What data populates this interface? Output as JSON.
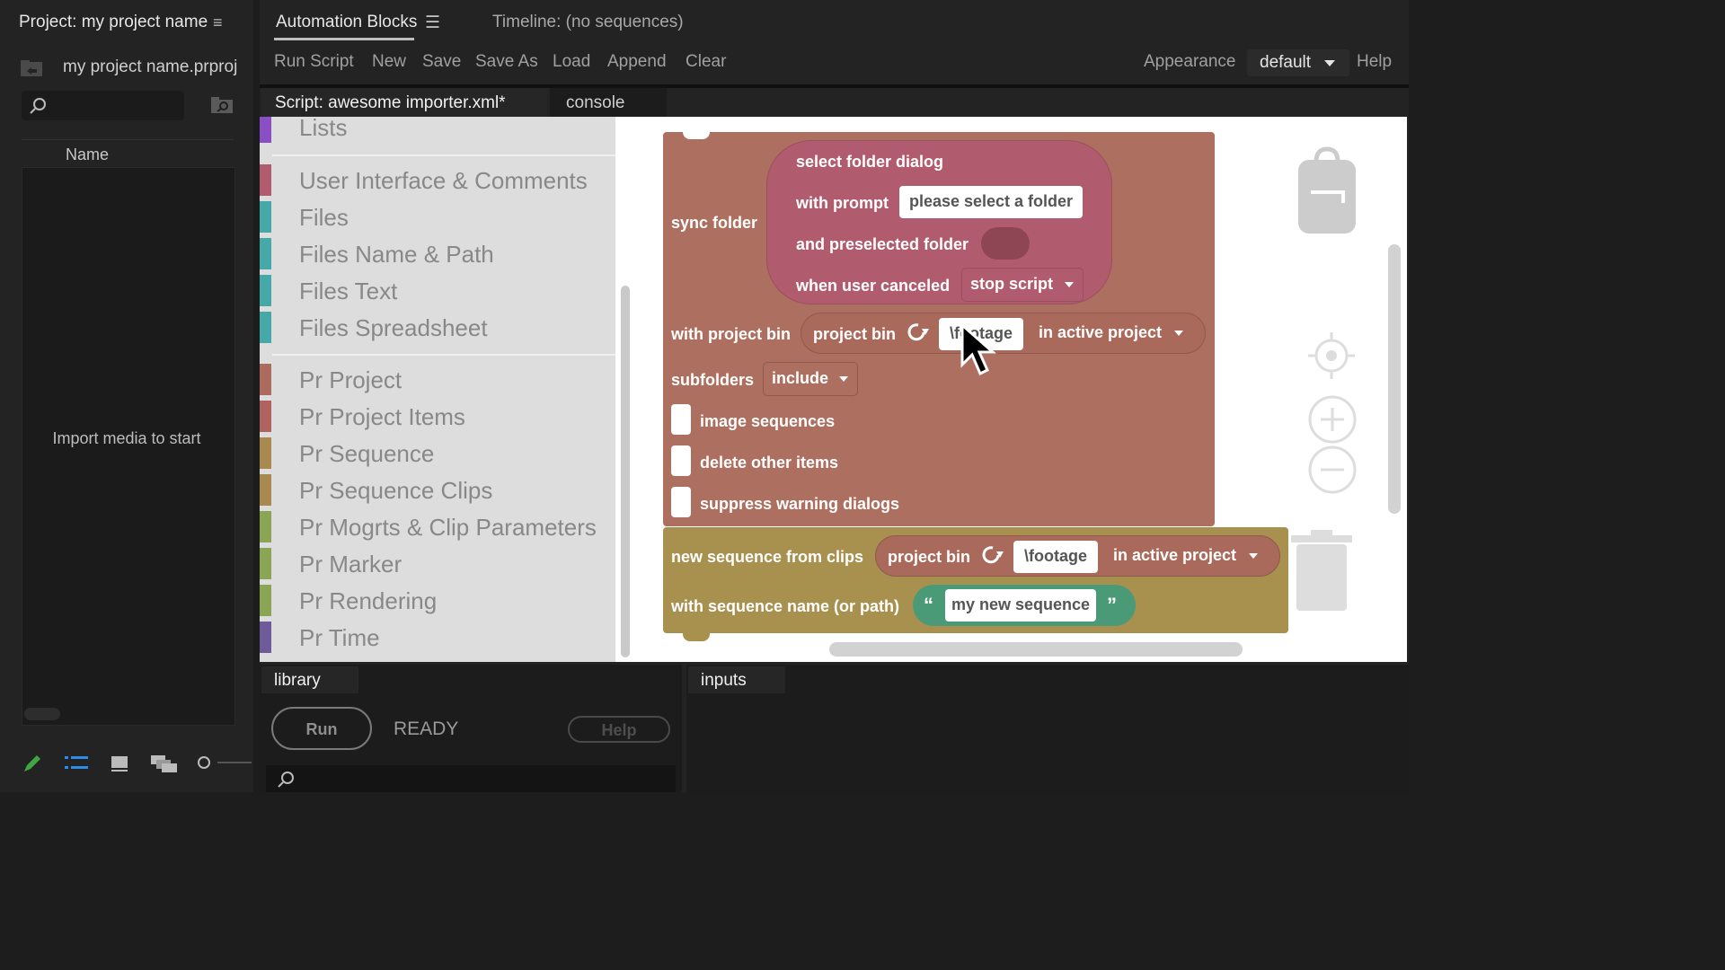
{
  "project_panel": {
    "title": "Project: my project name",
    "menu_icon": "hamburger-icon",
    "file_name": "my project name.prproj",
    "column_header": "Name",
    "empty_message": "Import media to start"
  },
  "tabs": {
    "automation": "Automation Blocks",
    "timeline": "Timeline: (no sequences)"
  },
  "toolbar": {
    "run_script": "Run Script",
    "new": "New",
    "save": "Save",
    "save_as": "Save As",
    "load": "Load",
    "append": "Append",
    "clear": "Clear",
    "appearance": "Appearance",
    "appearance_value": "default",
    "help": "Help"
  },
  "editor_tabs": {
    "script": "Script: awesome importer.xml*",
    "console": "console"
  },
  "toolbox": {
    "categories": [
      {
        "label": "Lists",
        "color": "#8a4fc4"
      },
      {
        "label": "User Interface & Comments",
        "color": "#b05c6e"
      },
      {
        "label": "Files",
        "color": "#45a9a9"
      },
      {
        "label": "Files Name & Path",
        "color": "#45a9a9"
      },
      {
        "label": "Files Text",
        "color": "#45a9a9"
      },
      {
        "label": "Files Spreadsheet",
        "color": "#45a9a9"
      },
      {
        "label": "Pr Project",
        "color": "#ad6b5f"
      },
      {
        "label": "Pr Project Items",
        "color": "#b0625f"
      },
      {
        "label": "Pr Sequence",
        "color": "#a88a50"
      },
      {
        "label": "Pr Sequence Clips",
        "color": "#a88a50"
      },
      {
        "label": "Pr Mogrts & Clip Parameters",
        "color": "#8aa553"
      },
      {
        "label": "Pr Marker",
        "color": "#8aa553"
      },
      {
        "label": "Pr Rendering",
        "color": "#8aa553"
      },
      {
        "label": "Pr Time",
        "color": "#6f5b9a"
      }
    ]
  },
  "blocks": {
    "sync_folder": {
      "label": "sync folder",
      "color": "#ad6f5f",
      "dialog": {
        "label": "select folder dialog",
        "prompt_label": "with prompt",
        "prompt_value": "please select a folder",
        "preselected_label": "and preselected folder",
        "canceled_label": "when user canceled",
        "canceled_value": "stop script",
        "color": "#b05c6e"
      },
      "project_bin_label": "with project bin",
      "bin_label": "project bin",
      "bin_path": "\\footage",
      "bin_scope": "in active project",
      "subfolders_label": "subfolders",
      "subfolders_value": "include",
      "checkbox_image_sequences": "image sequences",
      "checkbox_delete_other": "delete other items",
      "checkbox_suppress_warnings": "suppress warning dialogs"
    },
    "new_sequence": {
      "label": "new sequence from clips",
      "color": "#a8904f",
      "bin_label": "project bin",
      "bin_path": "\\footage",
      "bin_scope": "in active project",
      "name_label": "with sequence name (or path)",
      "open_quote": "“",
      "name_value": "my new sequence",
      "close_quote": "”",
      "string_color": "#4a9a77"
    }
  },
  "bottom": {
    "library_tab": "library",
    "inputs_tab": "inputs",
    "run": "Run",
    "status": "READY",
    "help": "Help"
  }
}
